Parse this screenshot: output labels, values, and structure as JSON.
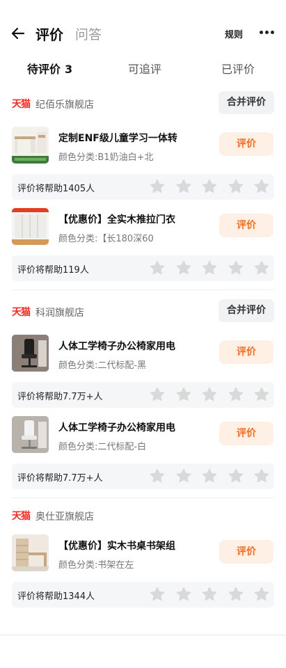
{
  "header": {
    "title": "评价",
    "qa_tab": "问答",
    "rules": "规则"
  },
  "tabs": [
    {
      "label": "待评价",
      "count": "3"
    },
    {
      "label": "可追评"
    },
    {
      "label": "已评价"
    }
  ],
  "merge_label": "合并评价",
  "rate_label": "评价",
  "tmall_label": "天猫",
  "shops": [
    {
      "name": "纪佰乐旗舰店",
      "tmall": true,
      "has_merge": true,
      "items": [
        {
          "title": "定制ENF级儿童学习一体转",
          "spec": "颜色分类:B1奶油白+北",
          "help": "评价将帮助1405人"
        },
        {
          "title": "【优惠价】全实木推拉门衣",
          "spec": "颜色分类:【长180深60",
          "help": "评价将帮助119人"
        }
      ]
    },
    {
      "name": "科润旗舰店",
      "tmall": true,
      "has_merge": true,
      "items": [
        {
          "title": "人体工学椅子办公椅家用电",
          "spec": "颜色分类:二代标配-黑",
          "help": "评价将帮助7.7万+人"
        },
        {
          "title": "人体工学椅子办公椅家用电",
          "spec": "颜色分类:二代标配-白",
          "help": "评价将帮助7.7万+人"
        }
      ]
    },
    {
      "name": "奥仕亚旗舰店",
      "tmall": true,
      "has_merge": false,
      "items": [
        {
          "title": "【优惠价】实木书桌书架组",
          "spec": "颜色分类:书架在左",
          "help": "评价将帮助1344人"
        }
      ]
    }
  ],
  "colors": {
    "accent_orange": "#ff6a1a",
    "accent_bg": "#fff0e6",
    "tmall_red": "#ff2a1f",
    "star_grey": "#d9d9d9"
  },
  "icons": [
    "back-arrow-icon",
    "more-icon",
    "star-icon"
  ]
}
